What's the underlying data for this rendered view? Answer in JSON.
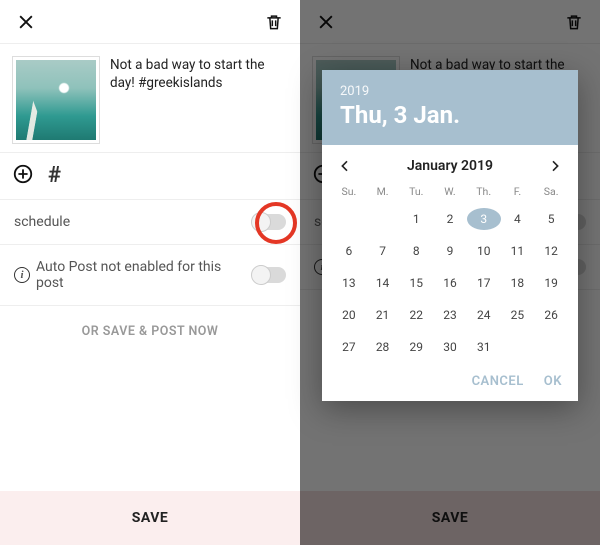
{
  "left": {
    "caption": "Not a bad way to start the day! #greekislands",
    "schedule_label": "schedule",
    "autopost_label": "Auto Post not enabled for this post",
    "or_save_post_label": "OR SAVE & POST NOW",
    "save_label": "SAVE"
  },
  "right_bg": {
    "caption": "Not a bad way to start the day! #greekislands",
    "sch_abbrev": "sch",
    "save_label": "SAVE"
  },
  "picker": {
    "year": "2019",
    "date_display": "Thu, 3 Jan.",
    "month_label": "January 2019",
    "dow": [
      "Su.",
      "M.",
      "Tu.",
      "W.",
      "Th.",
      "F.",
      "Sa."
    ],
    "leading_blanks": 2,
    "days": [
      1,
      2,
      3,
      4,
      5,
      6,
      7,
      8,
      9,
      10,
      11,
      12,
      13,
      14,
      15,
      16,
      17,
      18,
      19,
      20,
      21,
      22,
      23,
      24,
      25,
      26,
      27,
      28,
      29,
      30,
      31
    ],
    "selected_day": 3,
    "cancel_label": "CANCEL",
    "ok_label": "OK"
  },
  "colors": {
    "accent_red": "#e43725",
    "picker_blue": "#a7bfcf",
    "save_bg": "#fbeeee"
  }
}
